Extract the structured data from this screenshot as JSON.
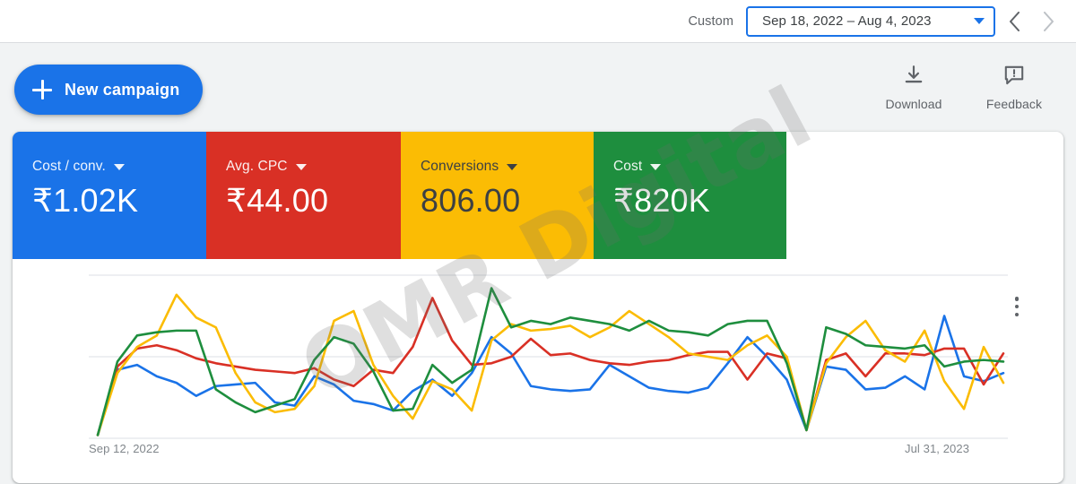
{
  "header": {
    "custom_label": "Custom",
    "date_range": "Sep 18, 2022 – Aug 4, 2023",
    "prev_arrow": "chevron-left-icon",
    "next_arrow": "chevron-right-icon"
  },
  "toolbar": {
    "new_campaign_label": "New campaign",
    "download_label": "Download",
    "feedback_label": "Feedback"
  },
  "metrics": [
    {
      "label": "Cost / conv.",
      "value": "₹1.02K",
      "color": "#1a73e8"
    },
    {
      "label": "Avg. CPC",
      "value": "₹44.00",
      "color": "#d93025"
    },
    {
      "label": "Conversions",
      "value": "806.00",
      "color": "#fbbc04"
    },
    {
      "label": "Cost",
      "value": "₹820K",
      "color": "#1e8e3e"
    }
  ],
  "watermark": {
    "text": "OMR Digital"
  },
  "chart_data": {
    "type": "line",
    "title": "",
    "xlabel": "",
    "ylabel": "",
    "grid": true,
    "legend_position": "none",
    "axis_start_label": "Sep 12, 2022",
    "axis_end_label": "Jul 31, 2023",
    "x_count": 47,
    "ylim": [
      0,
      100
    ],
    "gridline_values": [
      100,
      50,
      0
    ],
    "series": [
      {
        "name": "Cost / conv.",
        "color": "#1a73e8",
        "values": [
          2,
          42,
          45,
          38,
          34,
          26,
          32,
          33,
          34,
          22,
          20,
          38,
          33,
          23,
          21,
          17,
          29,
          36,
          26,
          40,
          62,
          52,
          32,
          30,
          29,
          30,
          45,
          38,
          31,
          29,
          28,
          31,
          46,
          62,
          50,
          36,
          5,
          44,
          42,
          30,
          31,
          38,
          30,
          75,
          38,
          35,
          40
        ]
      },
      {
        "name": "Avg. CPC",
        "color": "#d93025",
        "values": [
          2,
          44,
          55,
          57,
          54,
          49,
          46,
          44,
          42,
          41,
          40,
          43,
          36,
          32,
          42,
          40,
          56,
          86,
          60,
          45,
          46,
          50,
          61,
          51,
          52,
          48,
          46,
          45,
          47,
          48,
          51,
          53,
          53,
          36,
          52,
          49,
          5,
          48,
          52,
          38,
          52,
          52,
          51,
          55,
          55,
          33,
          52
        ]
      },
      {
        "name": "Conversions",
        "color": "#fbbc04",
        "values": [
          2,
          40,
          56,
          63,
          88,
          74,
          68,
          40,
          22,
          16,
          18,
          32,
          72,
          78,
          45,
          26,
          12,
          35,
          30,
          17,
          60,
          70,
          66,
          67,
          69,
          62,
          68,
          78,
          70,
          62,
          52,
          50,
          48,
          57,
          63,
          50,
          5,
          46,
          62,
          72,
          54,
          47,
          66,
          35,
          18,
          56,
          34
        ]
      },
      {
        "name": "Cost",
        "color": "#1e8e3e",
        "values": [
          2,
          47,
          63,
          65,
          66,
          66,
          30,
          22,
          16,
          20,
          24,
          48,
          62,
          58,
          41,
          17,
          18,
          45,
          34,
          42,
          92,
          68,
          72,
          70,
          74,
          72,
          70,
          66,
          72,
          66,
          65,
          63,
          70,
          72,
          72,
          46,
          5,
          68,
          64,
          57,
          56,
          55,
          57,
          44,
          47,
          48,
          47
        ]
      }
    ]
  }
}
